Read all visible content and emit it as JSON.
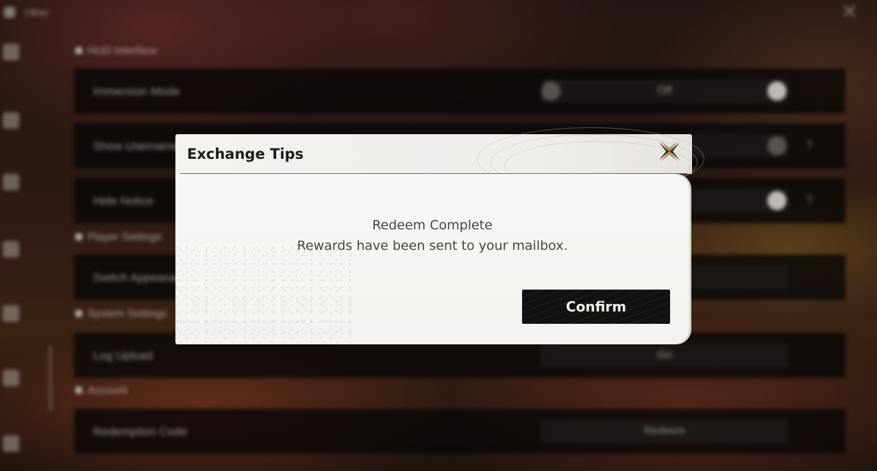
{
  "background": {
    "window_title": "Other",
    "sections": [
      {
        "title": "HUD Interface"
      },
      {
        "title": "Player Settings"
      },
      {
        "title": "System Settings"
      },
      {
        "title": "Account"
      }
    ],
    "rows": [
      {
        "label": "Immersion Mode",
        "value": "Off"
      },
      {
        "label": "Show Username",
        "value": ""
      },
      {
        "label": "Hide Notice",
        "value": ""
      },
      {
        "label": "Switch Appearance",
        "value": ""
      },
      {
        "label": "Log Upload",
        "value": "Go"
      },
      {
        "label": "Redemption Code",
        "value": "Redeem"
      }
    ],
    "help_glyph": "?"
  },
  "dialog": {
    "title": "Exchange Tips",
    "message_line1": "Redeem Complete",
    "message_line2": "Rewards have been sent to your mailbox.",
    "confirm_label": "Confirm",
    "close_icon": "close-x-icon"
  },
  "colors": {
    "dialog_bg": "#f4f2ef",
    "button_bg": "#121010",
    "accent_gold": "#b08d57"
  }
}
